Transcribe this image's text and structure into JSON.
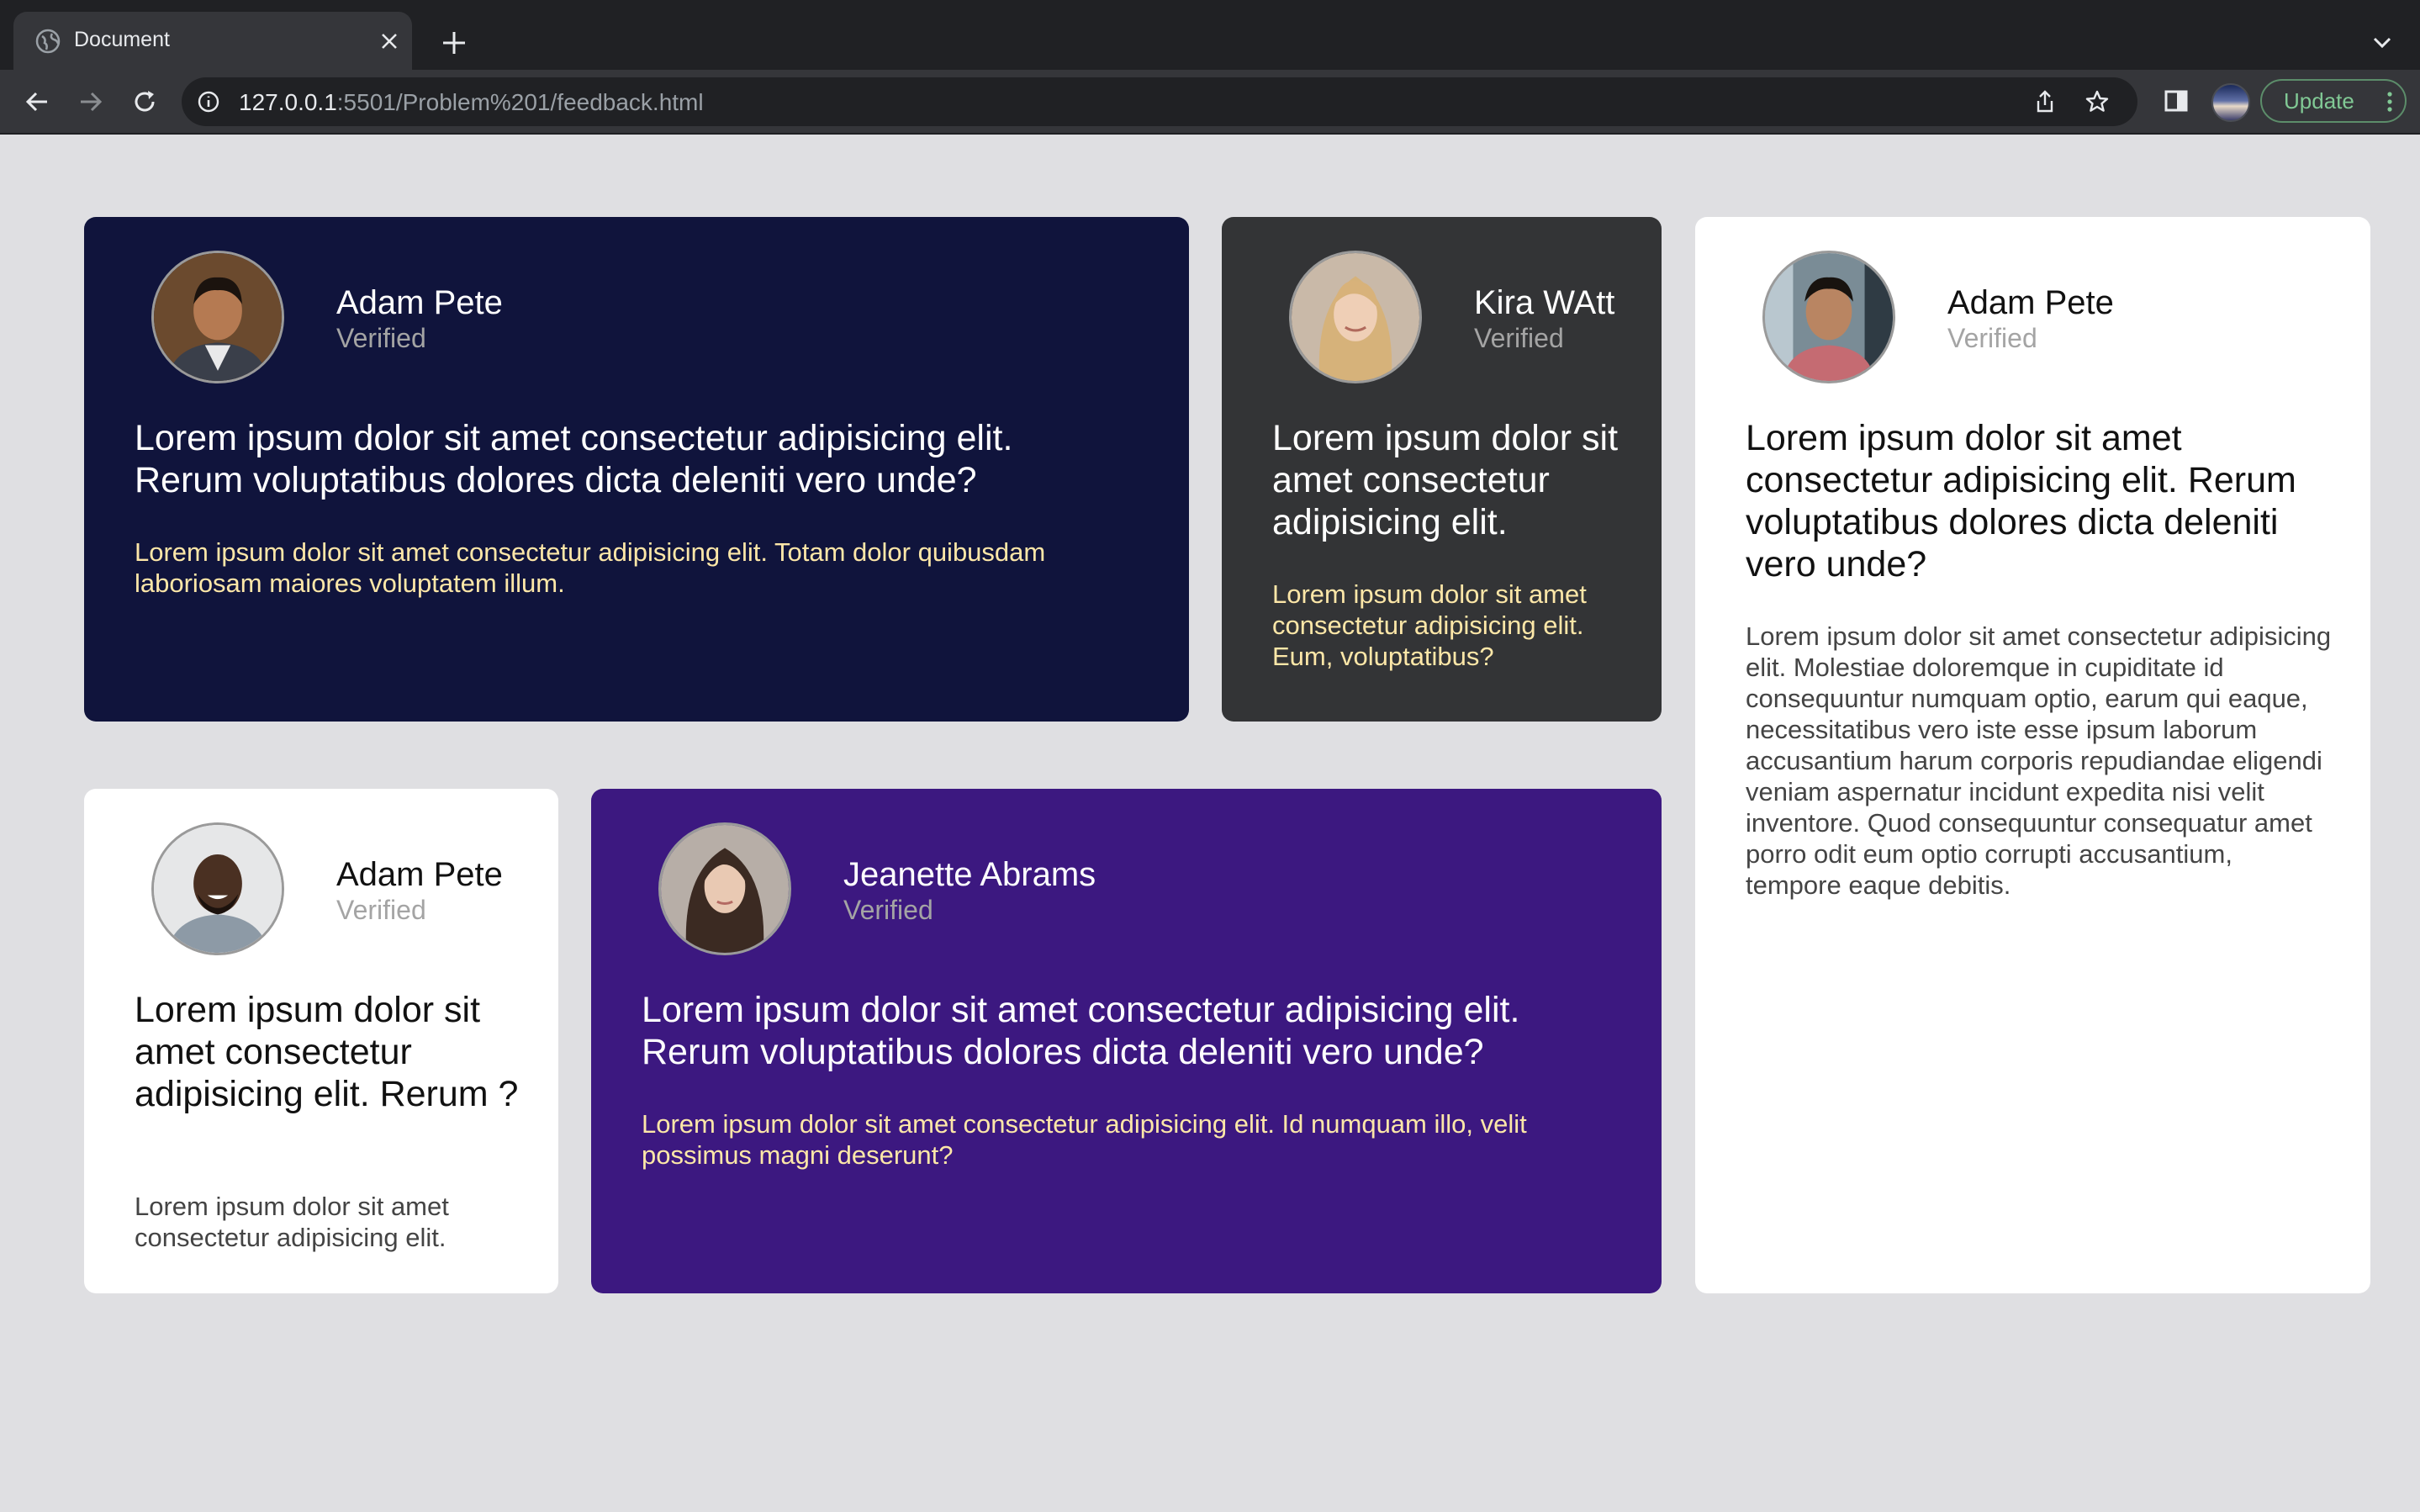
{
  "browser": {
    "tab_title": "Document",
    "url_host": "127.0.0.1",
    "url_rest": ":5501/Problem%201/feedback.html",
    "update_label": "Update",
    "icons": [
      "globe-icon",
      "close-icon",
      "plus-icon",
      "chevron-down-icon",
      "back-icon",
      "forward-icon",
      "reload-icon",
      "info-icon",
      "share-icon",
      "star-icon",
      "side-panel-icon",
      "kebab-menu-icon"
    ]
  },
  "colors": {
    "page_bg": "#dfdfe2",
    "card_navy": "#10143c",
    "card_charcoal": "#333436",
    "card_white": "#ffffff",
    "card_purple": "#3c1880",
    "accent_text": "#fde7a8",
    "verified_text": "#a4a4a4"
  },
  "cards": [
    {
      "name": "Adam Pete",
      "status": "Verified",
      "headline": "Lorem ipsum dolor sit amet consectetur adipisicing elit. Rerum voluptatibus dolores dicta deleniti vero unde?",
      "body": "Lorem ipsum dolor sit amet consectetur adipisicing elit. Totam dolor quibusdam laboriosam maiores voluptatem illum."
    },
    {
      "name": "Kira WAtt",
      "status": "Verified",
      "headline": "Lorem ipsum dolor sit amet consectetur adipisicing elit.",
      "body": "Lorem ipsum dolor sit amet consectetur adipisicing elit. Eum, voluptatibus?"
    },
    {
      "name": "Adam Pete",
      "status": "Verified",
      "headline": "Lorem ipsum dolor sit amet consectetur adipisicing elit. Rerum voluptatibus dolores dicta deleniti vero unde?",
      "body": "Lorem ipsum dolor sit amet consectetur adipisicing elit. Molestiae doloremque in cupiditate id consequuntur numquam optio, earum qui eaque, necessitatibus vero iste esse ipsum laborum accusantium harum corporis repudiandae eligendi veniam aspernatur incidunt expedita nisi velit inventore. Quod consequuntur consequatur amet porro odit eum optio corrupti accusantium, tempore eaque debitis."
    },
    {
      "name": "Adam Pete",
      "status": "Verified",
      "headline": "Lorem ipsum dolor sit amet consectetur adipisicing elit. Rerum ?",
      "body": "Lorem ipsum dolor sit amet consectetur adipisicing elit."
    },
    {
      "name": "Jeanette Abrams",
      "status": "Verified",
      "headline": "Lorem ipsum dolor sit amet consectetur adipisicing elit. Rerum voluptatibus dolores dicta deleniti vero unde?",
      "body": "Lorem ipsum dolor sit amet consectetur adipisicing elit. Id numquam illo, velit possimus magni deserunt?"
    }
  ]
}
